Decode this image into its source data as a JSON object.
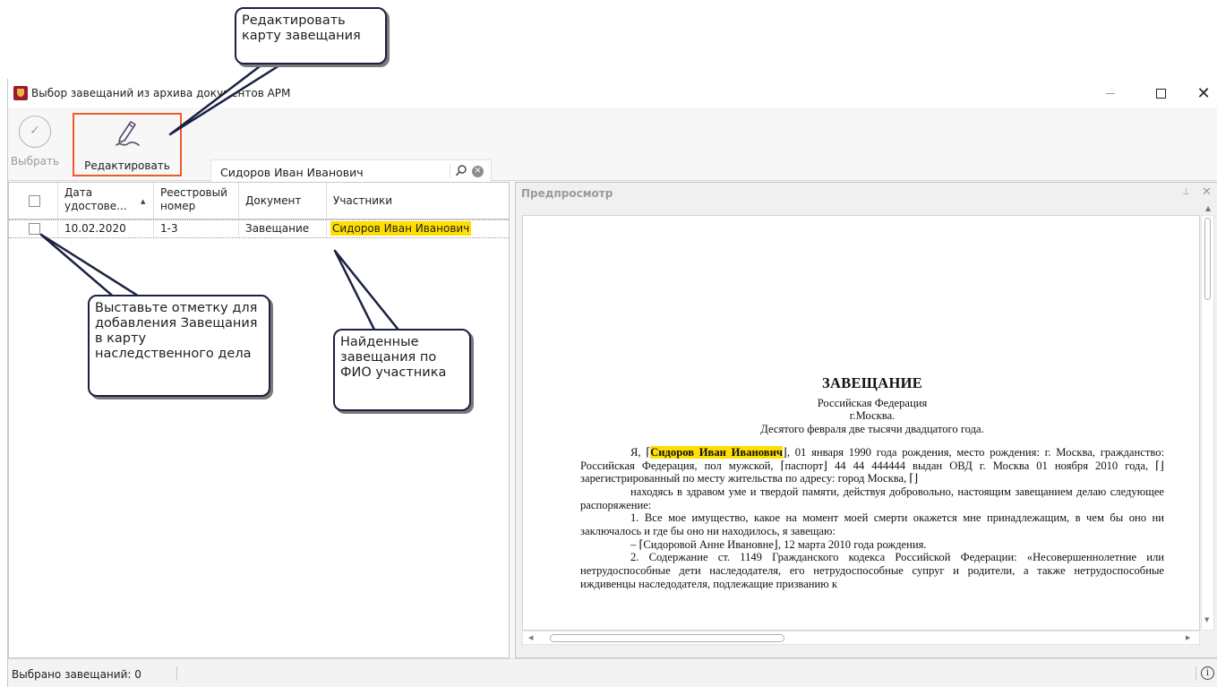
{
  "window": {
    "title": "Выбор завещаний из архива документов АРМ",
    "minimize": "—",
    "maximize": "",
    "close": "✕"
  },
  "toolbar": {
    "select_label": "Выбрать",
    "select_icon": "checkmark-circle-icon",
    "edit_label": "Редактировать",
    "edit_icon": "pen-signature-icon",
    "search_value": "Сидоров Иван Иванович",
    "search_icon": "magnifier-icon",
    "clear_icon": "clear-circle-icon"
  },
  "grid": {
    "columns": [
      {
        "label": "Дата удостове..."
      },
      {
        "label": "Реестровый номер"
      },
      {
        "label": "Документ"
      },
      {
        "label": "Участники"
      }
    ],
    "rows": [
      {
        "date": "10.02.2020",
        "reg_no": "1-3",
        "document": "Завещание",
        "participants": "Сидоров Иван Иванович"
      }
    ]
  },
  "preview": {
    "title": "Предпросмотр",
    "doc": {
      "heading": "ЗАВЕЩАНИЕ",
      "country": "Российская Федерация",
      "city": "г.Москва.",
      "date": "Десятого февраля две тысячи двадцатого года.",
      "p1_a": "Я, ⌈",
      "p1_name": "Сидоров Иван Иванович",
      "p1_b": "⌋, 01 января 1990 года рождения, место рождения: г. Москва, гражданство: Российская Федерация, пол мужской, ⌈паспорт⌋ 44 44 444444 выдан ОВД г. Москва 01 ноября 2010 года, ⌈⌋зарегистрированный по месту жительства по адресу: город Москва, ⌈⌋",
      "p2": "находясь в здравом уме и твердой памяти, действуя добровольно, настоящим завещанием делаю следующее распоряжение:",
      "p3": "1. Все мое имущество, какое на момент моей смерти окажется мне принадлежащим, в чем бы оно ни заключалось и где бы оно ни находилось, я завещаю:",
      "p4": "– ⌈Сидоровой Анне Ивановне⌋, 12 марта 2010 года рождения.",
      "p5": "2. Содержание ст. 1149 Гражданского кодекса Российской Федерации: «Несовершеннолетние или нетрудоспособные дети наследодателя, его нетрудоспособные супруг и родители, а также нетрудоспособные иждивенцы наследодателя, подлежащие призванию к"
    }
  },
  "status": {
    "selected_text": "Выбрано завещаний: 0",
    "info_icon": "info-icon"
  },
  "callouts": {
    "edit": "Редактировать карту завещания",
    "check": "Выставьте отметку для добавления Завещания в карту наследственного дела",
    "found": "Найденные завещания по ФИО участника"
  },
  "colors": {
    "highlight": "#ffde00",
    "accent_box": "#ef5a2a",
    "callout_border": "#1b2140"
  }
}
